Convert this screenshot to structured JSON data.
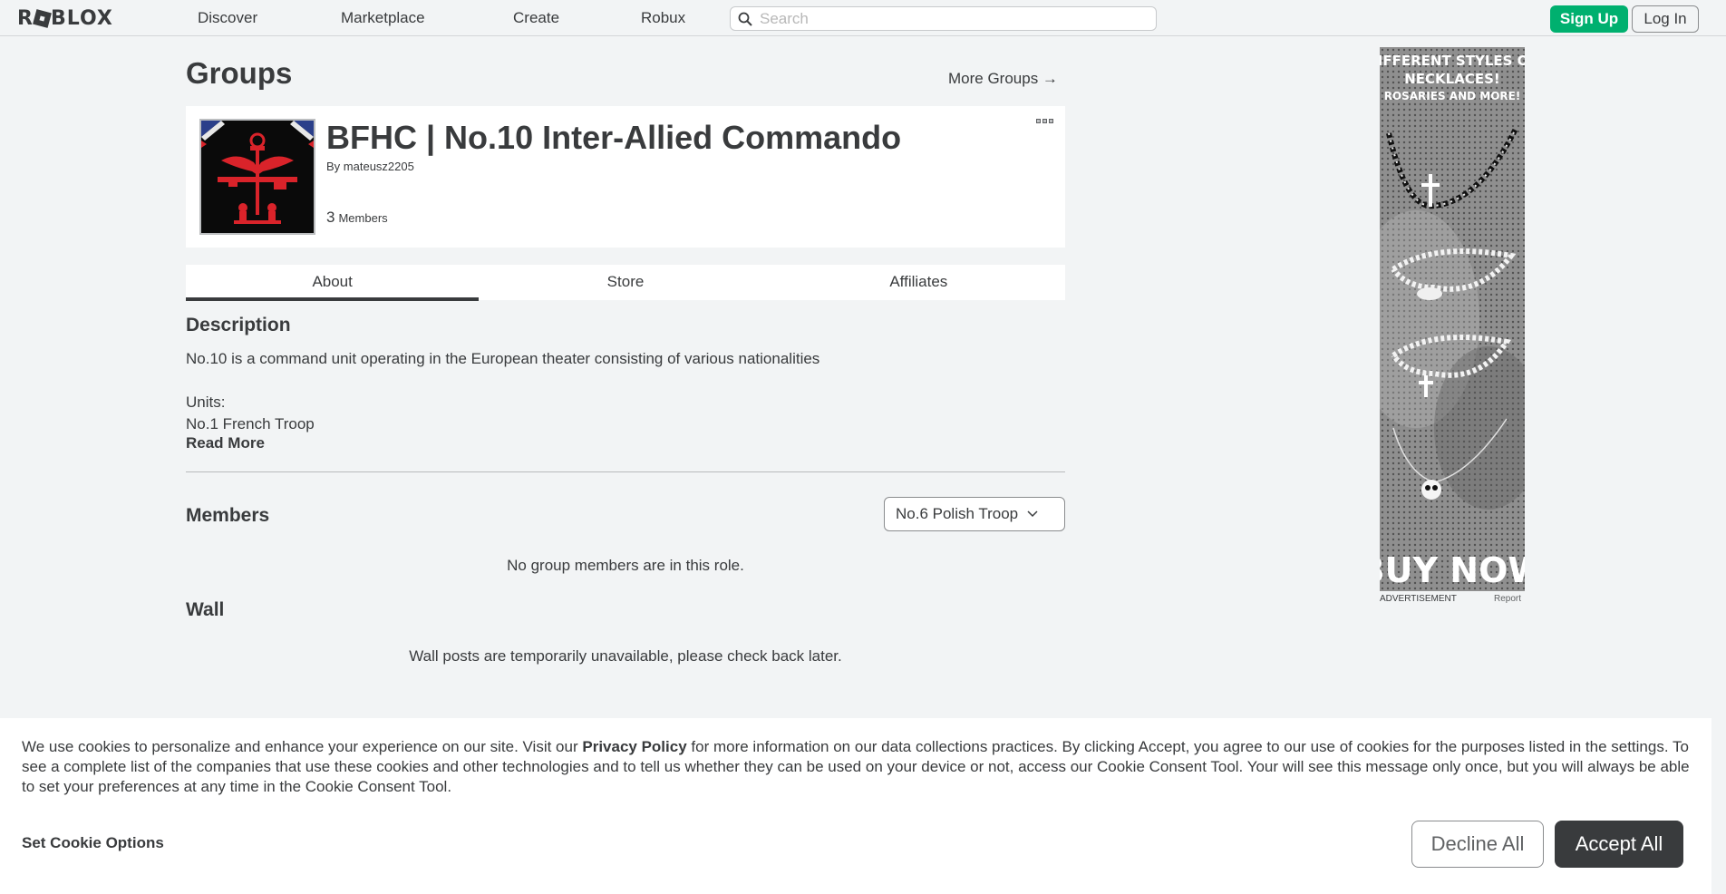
{
  "nav": {
    "logo": "ROBLOX",
    "links": [
      "Discover",
      "Marketplace",
      "Create",
      "Robux"
    ],
    "search_placeholder": "Search",
    "signup": "Sign Up",
    "login": "Log In"
  },
  "page": {
    "title": "Groups",
    "more_groups": "More Groups →"
  },
  "group": {
    "name": "BFHC | No.10 Inter-Allied Commando",
    "by_label": "By",
    "owner": "mateusz2205",
    "member_count": "3",
    "member_label": "Members"
  },
  "tabs": [
    "About",
    "Store",
    "Affiliates"
  ],
  "about": {
    "description_title": "Description",
    "description": "No.10 is a command unit operating in the European theater consisting of various nationalities\n\nUnits:\nNo.1 French Troop",
    "read_more": "Read More",
    "members_title": "Members",
    "role_selected": "No.6 Polish Troop",
    "members_empty": "No group members are in this role.",
    "wall_title": "Wall",
    "wall_empty": "Wall posts are temporarily unavailable, please check back later."
  },
  "ad": {
    "headline_1": "DIFFERENT STYLES OF",
    "headline_2": "NECKLACES!",
    "headline_3": "ROSARIES AND MORE!",
    "cta": "BUY NOW",
    "label": "ADVERTISEMENT",
    "report": "Report"
  },
  "cookie": {
    "text_before": "We use cookies to personalize and enhance your experience on our site. Visit our ",
    "policy_link": "Privacy Policy",
    "text_after": " for more information on our data collections practices. By clicking Accept, you agree to our use of cookies for the purposes listed in the settings. To see a complete list of the companies that use these cookies and other technologies and to tell us whether they can be used on your device or not, access our Cookie Consent Tool. Your will see this message only once, but you will always be able to set your preferences at any time in the Cookie Consent Tool.",
    "set_options": "Set Cookie Options",
    "decline": "Decline All",
    "accept": "Accept All"
  },
  "colors": {
    "accent_green": "#00b06f",
    "text": "#393b3d",
    "background": "#f2f4f5",
    "emblem_red": "#d9232a"
  }
}
